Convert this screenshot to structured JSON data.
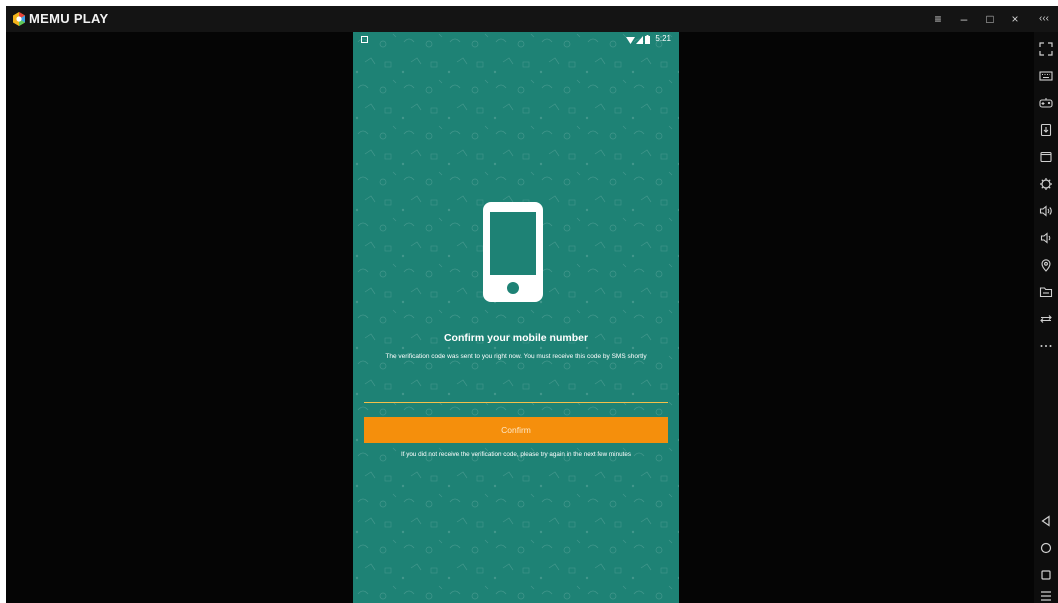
{
  "window": {
    "brand": "MEMU PLAY",
    "controls": {
      "menu": "≡",
      "minimize": "–",
      "maximize": "□",
      "close": "×",
      "collapse": "‹‹‹"
    }
  },
  "sidebar": {
    "icons": [
      "fullscreen-icon",
      "keyboard-icon",
      "gamepad-icon",
      "install-apk-icon",
      "window-icon",
      "settings-icon",
      "volume-up-icon",
      "volume-down-icon",
      "location-icon",
      "folder-icon",
      "rotate-icon",
      "more-icon",
      "back-icon",
      "home-icon",
      "recent-apps-icon",
      "menu-icon"
    ]
  },
  "phone": {
    "status_time": "5:21",
    "title": "Confirm your mobile number",
    "description": "The verification code was sent to you right now. You must receive this code by SMS shortly",
    "code_value": "",
    "confirm_label": "Confirm",
    "hint": "If you did not receive the verification code, please try again in the next few minutes"
  },
  "colors": {
    "screen_bg": "#1e8275",
    "button": "#f58f0c",
    "input_underline": "#f3c04a",
    "emulator_bg": "#050505"
  }
}
